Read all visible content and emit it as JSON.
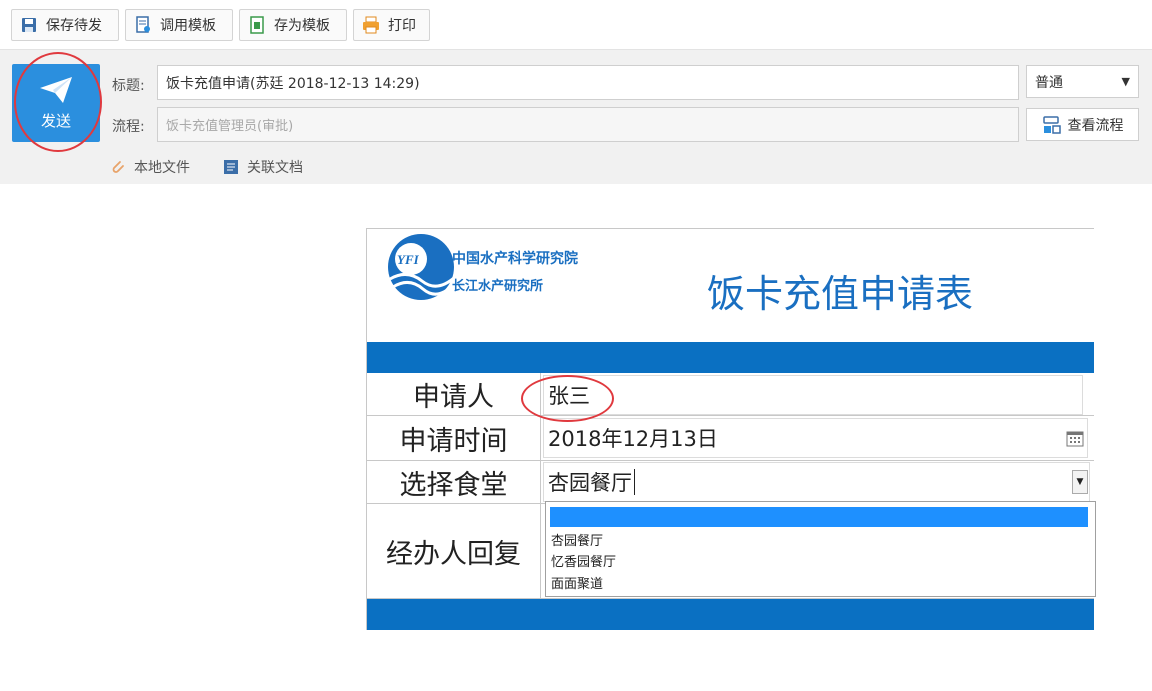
{
  "toolbar": {
    "save_draft": "保存待发",
    "use_template": "调用模板",
    "save_template": "存为模板",
    "print": "打印"
  },
  "header": {
    "send_label": "发送",
    "title_label": "标题:",
    "title_value": "饭卡充值申请(苏廷 2018-12-13 14:29)",
    "flow_label": "流程:",
    "flow_value": "饭卡充值管理员(审批)",
    "priority_value": "普通",
    "view_flow_label": "查看流程",
    "local_file_label": "本地文件",
    "related_doc_label": "关联文档"
  },
  "form": {
    "logo_text": "YFI",
    "org_name_1": "中国水产科学研究院",
    "org_name_2": "长江水产研究所",
    "title": "饭卡充值申请表",
    "rows": [
      {
        "label": "申请人",
        "value": "张三"
      },
      {
        "label": "申请时间",
        "value": "2018年12月13日"
      },
      {
        "label": "选择食堂",
        "value": "杏园餐厅"
      },
      {
        "label": "经办人回复",
        "value": ""
      }
    ],
    "canteen_options": [
      "",
      "杏园餐厅",
      "忆香园餐厅",
      "面面聚道"
    ]
  },
  "colors": {
    "accent": "#2b8fde",
    "form_bar": "#0a70c2",
    "title_blue": "#1a6fc1",
    "annotation_red": "#e0393e"
  }
}
